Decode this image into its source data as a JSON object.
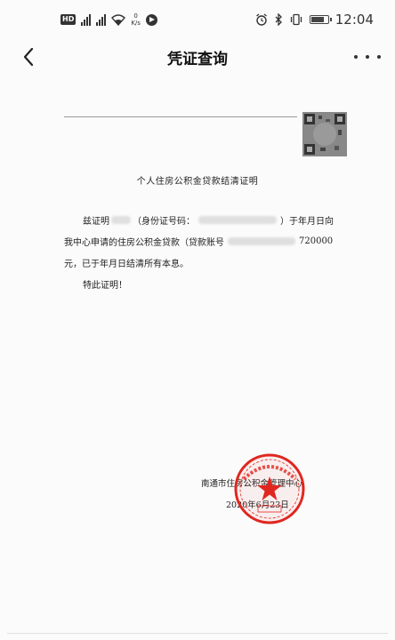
{
  "status_bar": {
    "hd_label": "HD",
    "signal1_type": "2G",
    "signal2_type": "4G",
    "net_speed_value": "0",
    "net_speed_unit": "K/s",
    "time": "12:04",
    "battery_level": 0.85
  },
  "nav": {
    "title": "凭证查询"
  },
  "document": {
    "title": "个人住房公积金贷款结清证明",
    "line1": {
      "a": "兹证明",
      "b": "（身份证号码：",
      "c": "）于年月日向"
    },
    "line2": {
      "a": "我中心申请的住房公积金贷款（贷款账号",
      "b": "720000"
    },
    "line3": "元，已于年月日结清所有本息。",
    "line4": "特此证明！",
    "issuer": "南通市住房公积金管理中心",
    "date": "2020年6月23日"
  },
  "colors": {
    "seal": "#e0271f",
    "text": "#222222",
    "background": "#fbfbfb"
  }
}
